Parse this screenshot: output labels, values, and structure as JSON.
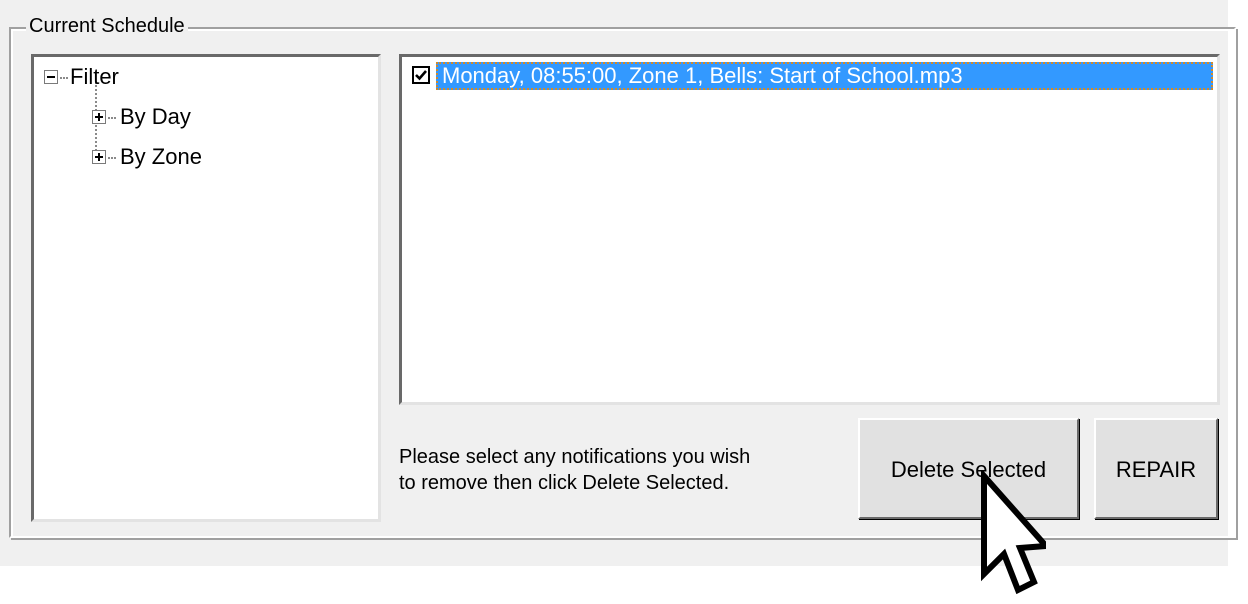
{
  "groupbox": {
    "title": "Current Schedule"
  },
  "tree": {
    "root": {
      "label": "Filter",
      "expander": "-"
    },
    "children": [
      {
        "label": "By Day",
        "expander": "+"
      },
      {
        "label": "By Zone",
        "expander": "+"
      }
    ]
  },
  "list": {
    "rows": [
      {
        "checked": true,
        "text": "Monday, 08:55:00, Zone 1, Bells: Start of School.mp3"
      }
    ]
  },
  "instruction": {
    "line1": "Please select any notifications you wish",
    "line2": "to remove then click Delete Selected."
  },
  "buttons": {
    "delete_label": "Delete Selected",
    "repair_label": "REPAIR"
  },
  "icons": {
    "cursor": "arrow-pointer-icon",
    "collapse": "minus-box-icon",
    "expand": "plus-box-icon",
    "check": "checkmark-icon"
  },
  "colors": {
    "selection": "#3399ff",
    "window": "#f0f0f0",
    "button": "#e1e1e1"
  }
}
